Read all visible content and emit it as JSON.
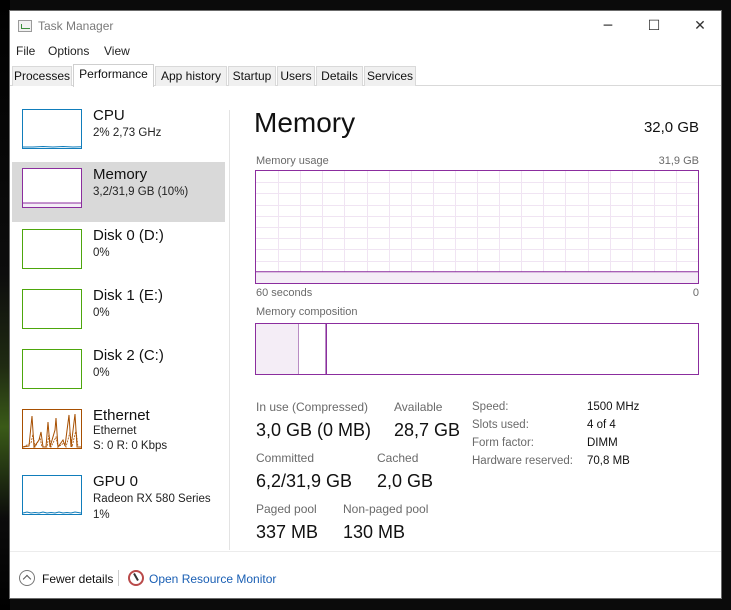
{
  "window": {
    "title": "Task Manager",
    "controls": {
      "minimize": "─",
      "maximize": "☐",
      "close": "✕"
    }
  },
  "menu": [
    "File",
    "Options",
    "View"
  ],
  "tabs": [
    "Processes",
    "Performance",
    "App history",
    "Startup",
    "Users",
    "Details",
    "Services"
  ],
  "active_tab": "Performance",
  "sidebar": {
    "items": [
      {
        "name": "CPU",
        "sub1": "2% 2,73 GHz",
        "sub2": "",
        "graph_color": "#117dbb"
      },
      {
        "name": "Memory",
        "sub1": "3,2/31,9 GB (10%)",
        "sub2": "",
        "graph_color": "#8b2d9e",
        "selected": true
      },
      {
        "name": "Disk 0 (D:)",
        "sub1": "0%",
        "sub2": "",
        "graph_color": "#4da60c"
      },
      {
        "name": "Disk 1 (E:)",
        "sub1": "0%",
        "sub2": "",
        "graph_color": "#4da60c"
      },
      {
        "name": "Disk 2 (C:)",
        "sub1": "0%",
        "sub2": "",
        "graph_color": "#4da60c"
      },
      {
        "name": "Ethernet",
        "sub1": "Ethernet",
        "sub2": "S: 0 R: 0 Kbps",
        "graph_color": "#a74f01"
      },
      {
        "name": "GPU 0",
        "sub1": "Radeon RX 580 Series",
        "sub2": "1%",
        "graph_color": "#117dbb"
      }
    ]
  },
  "memory": {
    "title": "Memory",
    "total": "32,0 GB",
    "usage_label": "Memory usage",
    "usage_max": "31,9 GB",
    "time_left": "60 seconds",
    "time_right": "0",
    "composition_label": "Memory composition",
    "accent": "#8b2d9e",
    "usage_fraction": 0.1,
    "stats": {
      "in_use_label": "In use (Compressed)",
      "in_use_value": "3,0 GB (0 MB)",
      "available_label": "Available",
      "available_value": "28,7 GB",
      "committed_label": "Committed",
      "committed_value": "6,2/31,9 GB",
      "cached_label": "Cached",
      "cached_value": "2,0 GB",
      "paged_label": "Paged pool",
      "paged_value": "337 MB",
      "nonpaged_label": "Non-paged pool",
      "nonpaged_value": "130 MB"
    },
    "details": [
      {
        "label": "Speed:",
        "value": "1500 MHz"
      },
      {
        "label": "Slots used:",
        "value": "4 of 4"
      },
      {
        "label": "Form factor:",
        "value": "DIMM"
      },
      {
        "label": "Hardware reserved:",
        "value": "70,8 MB"
      }
    ]
  },
  "footer": {
    "fewer_details": "Fewer details",
    "open_monitor": "Open Resource Monitor"
  }
}
